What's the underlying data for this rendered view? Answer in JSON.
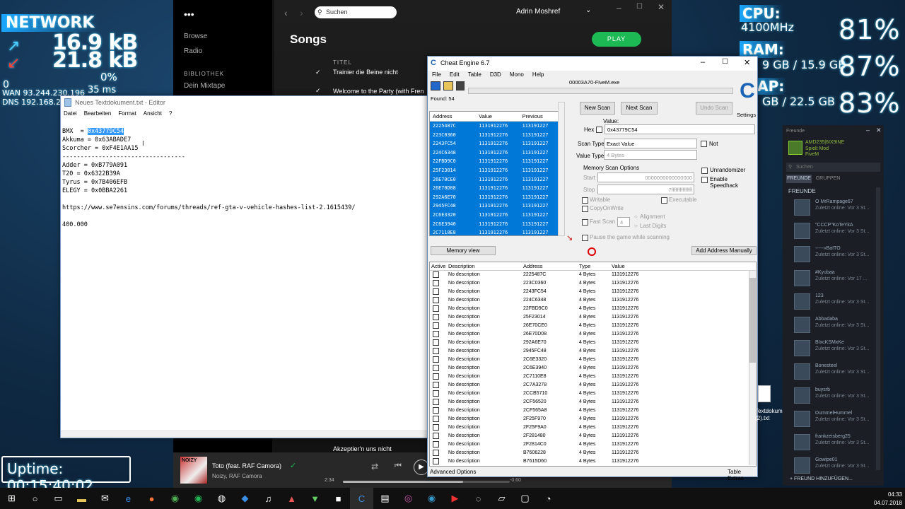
{
  "rainmeter": {
    "network_label": "NETWORK",
    "net_up": "16.9 kB",
    "net_down": "21.8 kB",
    "net_pct": "0%",
    "net_ms": "35 ms",
    "net_zero": "0",
    "wan": "WAN 93.244.230.196",
    "dns": "DNS 192.168.2.1",
    "uptime": "Uptime: 00:15:40:02",
    "cpu_label": "CPU:",
    "cpu_freq": "4100MHz",
    "cpu_pct": "81%",
    "ram_label": "RAM:",
    "ram_detail": "9 GB / 15.9 GB",
    "ram_pct": "87%",
    "swap_label": "WAP:",
    "swap_detail": "GB / 22.5 GB",
    "swap_pct": "83%"
  },
  "spotify": {
    "search_placeholder": "Suchen",
    "user": "Adrin Moshref",
    "sidebar": [
      "Browse",
      "Radio"
    ],
    "library_label": "BIBLIOTHEK",
    "mixtape": "Dein Mixtape",
    "page_title": "Songs",
    "play_label": "PLAY",
    "col_title": "TITEL",
    "songs": [
      "Trainier die Beine nicht",
      "Welcome to the Party (with Fren",
      "Akzeptier'n uns nicht"
    ],
    "now_title": "Toto (feat. RAF Camora)",
    "now_artist": "Noizy, RAF Camora",
    "time_elapsed": "2:34",
    "time_remaining": "-0:60",
    "cover_text": "NOIZY"
  },
  "notepad": {
    "title": "Neues Textdokument.txt - Editor",
    "menu": [
      "Datei",
      "Bearbeiten",
      "Format",
      "Ansicht",
      "?"
    ],
    "lines": [
      {
        "pre": "BMX  = ",
        "sel": "0x43779C54",
        "post": ""
      },
      {
        "pre": "Akkuma = 0x63ABADE7",
        "sel": "",
        "post": ""
      },
      {
        "pre": "Scorcher = 0xF4E1AA15",
        "sel": "",
        "post": ""
      },
      {
        "pre": "----------------------------------",
        "sel": "",
        "post": ""
      },
      {
        "pre": "Adder = 0xB779A091",
        "sel": "",
        "post": ""
      },
      {
        "pre": "T20 = 0x6322B39A",
        "sel": "",
        "post": ""
      },
      {
        "pre": "Tyrus = 0x7B406EFB",
        "sel": "",
        "post": ""
      },
      {
        "pre": "ELEGY = 0x0BBA2261",
        "sel": "",
        "post": ""
      },
      {
        "pre": "",
        "sel": "",
        "post": ""
      },
      {
        "pre": "https://www.se7ensins.com/forums/threads/ref-gta-v-vehicle-hashes-list-2.1615439/",
        "sel": "",
        "post": ""
      },
      {
        "pre": "",
        "sel": "",
        "post": ""
      },
      {
        "pre": "400.000",
        "sel": "",
        "post": ""
      }
    ]
  },
  "cheat_engine": {
    "title": "Cheat Engine 6.7",
    "menu": [
      "File",
      "Edit",
      "Table",
      "D3D",
      "Mono",
      "Help"
    ],
    "process": "00003A70-FiveM.exe",
    "found": "Found: 54",
    "found_cols": [
      "Address",
      "Value",
      "Previous"
    ],
    "found_rows": [
      [
        "2225487C",
        "1131912276",
        "113191227"
      ],
      [
        "223C0360",
        "1131912276",
        "113191227"
      ],
      [
        "2243FC54",
        "1131912276",
        "113191227"
      ],
      [
        "224C6348",
        "1131912276",
        "113191227"
      ],
      [
        "22FBD9C0",
        "1131912276",
        "113191227"
      ],
      [
        "25F23014",
        "1131912276",
        "113191227"
      ],
      [
        "26E70CE0",
        "1131912276",
        "113191227"
      ],
      [
        "26E70D08",
        "1131912276",
        "113191227"
      ],
      [
        "292A6E70",
        "1131912276",
        "113191227"
      ],
      [
        "2945FC48",
        "1131912276",
        "113191227"
      ],
      [
        "2C6E3320",
        "1131912276",
        "113191227"
      ],
      [
        "2C6E3940",
        "1131912276",
        "113191227"
      ],
      [
        "2C7110E8",
        "1131912276",
        "113191227"
      ]
    ],
    "new_scan": "New Scan",
    "next_scan": "Next Scan",
    "undo_scan": "Undo Scan",
    "settings": "Settings",
    "value_label": "Value:",
    "hex_label": "Hex",
    "value_input": "0x43779C54",
    "scan_type_label": "Scan Type",
    "scan_type": "Exact Value",
    "value_type_label": "Value Type",
    "value_type": "4 Bytes",
    "not_label": "Not",
    "mem_opts": "Memory Scan Options",
    "start_label": "Start",
    "start_val": "0000000000000000",
    "stop_label": "Stop",
    "stop_val": "7fffffffffffffff",
    "writable": "Writable",
    "executable": "Executable",
    "copyonwrite": "CopyOnWrite",
    "fastscan": "Fast Scan",
    "fastscan_val": "4",
    "alignment": "Alignment",
    "last_digits": "Last Digits",
    "pause": "Pause the game while scanning",
    "unrandomizer": "Unrandomizer",
    "speedhack": "Enable Speedhack",
    "memory_view": "Memory view",
    "add_manual": "Add Address Manually",
    "list_cols": [
      "Active",
      "Description",
      "Address",
      "Type",
      "Value"
    ],
    "list_rows": [
      [
        "No description",
        "2225487C",
        "4 Bytes",
        "1131912276"
      ],
      [
        "No description",
        "223C0360",
        "4 Bytes",
        "1131912276"
      ],
      [
        "No description",
        "2243FC54",
        "4 Bytes",
        "1131912276"
      ],
      [
        "No description",
        "224C6348",
        "4 Bytes",
        "1131912276"
      ],
      [
        "No description",
        "22FBD9C0",
        "4 Bytes",
        "1131912276"
      ],
      [
        "No description",
        "25F23014",
        "4 Bytes",
        "1131912276"
      ],
      [
        "No description",
        "26E70CE0",
        "4 Bytes",
        "1131912276"
      ],
      [
        "No description",
        "26E70D08",
        "4 Bytes",
        "1131912276"
      ],
      [
        "No description",
        "292A6E70",
        "4 Bytes",
        "1131912276"
      ],
      [
        "No description",
        "2945FC48",
        "4 Bytes",
        "1131912276"
      ],
      [
        "No description",
        "2C6E3320",
        "4 Bytes",
        "1131912276"
      ],
      [
        "No description",
        "2C6E3940",
        "4 Bytes",
        "1131912276"
      ],
      [
        "No description",
        "2C7110E8",
        "4 Bytes",
        "1131912276"
      ],
      [
        "No description",
        "2C7A3278",
        "4 Bytes",
        "1131912276"
      ],
      [
        "No description",
        "2CCB5710",
        "4 Bytes",
        "1131912276"
      ],
      [
        "No description",
        "2CF56520",
        "4 Bytes",
        "1131912276"
      ],
      [
        "No description",
        "2CF565A8",
        "4 Bytes",
        "1131912276"
      ],
      [
        "No description",
        "2F25F970",
        "4 Bytes",
        "1131912276"
      ],
      [
        "No description",
        "2F25F9A0",
        "4 Bytes",
        "1131912276"
      ],
      [
        "No description",
        "2F281480",
        "4 Bytes",
        "1131912276"
      ],
      [
        "No description",
        "2F2814C0",
        "4 Bytes",
        "1131912276"
      ],
      [
        "No description",
        "B7606228",
        "4 Bytes",
        "1131912276"
      ],
      [
        "No description",
        "B7615D60",
        "4 Bytes",
        "1131912276"
      ]
    ],
    "advanced": "Advanced Options",
    "table_extras": "Table Extras"
  },
  "steam": {
    "header": "Freunde",
    "self_name": "AMD235|6IX9INE",
    "self_status": "Spielt Mod",
    "self_game": "FiveM",
    "search": "Suchen",
    "tabs": [
      "FREUNDE",
      "GRUPPEN"
    ],
    "section": "FREUNDE",
    "friends": [
      {
        "name": "O MrRampage67",
        "status": "Zuletzt online: Vor 3 St..."
      },
      {
        "name": "\"CCCP\"KoTeYkA",
        "status": "Zuletzt online: Vor 3 St..."
      },
      {
        "name": "-----»BaITO",
        "status": "Zuletzt online: Vor 3 St..."
      },
      {
        "name": "#Kyubaa",
        "status": "Zuletzt online: Vor 17 ..."
      },
      {
        "name": "123",
        "status": "Zuletzt online: Vor 3 St..."
      },
      {
        "name": "Abbadaba",
        "status": "Zuletzt online: Vor 3 St..."
      },
      {
        "name": "BIxcKSMxKe",
        "status": "Zuletzt online: Vor 3 St..."
      },
      {
        "name": "Bonesteel",
        "status": "Zuletzt online: Vor 3 St..."
      },
      {
        "name": "buysrb",
        "status": "Zuletzt online: Vor 3 St..."
      },
      {
        "name": "DummelHummel",
        "status": "Zuletzt online: Vor 3 St..."
      },
      {
        "name": "frankzeisberg25",
        "status": "Zuletzt online: Vor 3 St..."
      },
      {
        "name": "Gowipe01",
        "status": "Zuletzt online: Vor 3 St..."
      }
    ],
    "add_friend": "+ FREUND HINZUFÜGEN..."
  },
  "desktop_file": "Textdokum (2).txt",
  "taskbar": {
    "time": "04:33",
    "date": "04.07.2018"
  }
}
